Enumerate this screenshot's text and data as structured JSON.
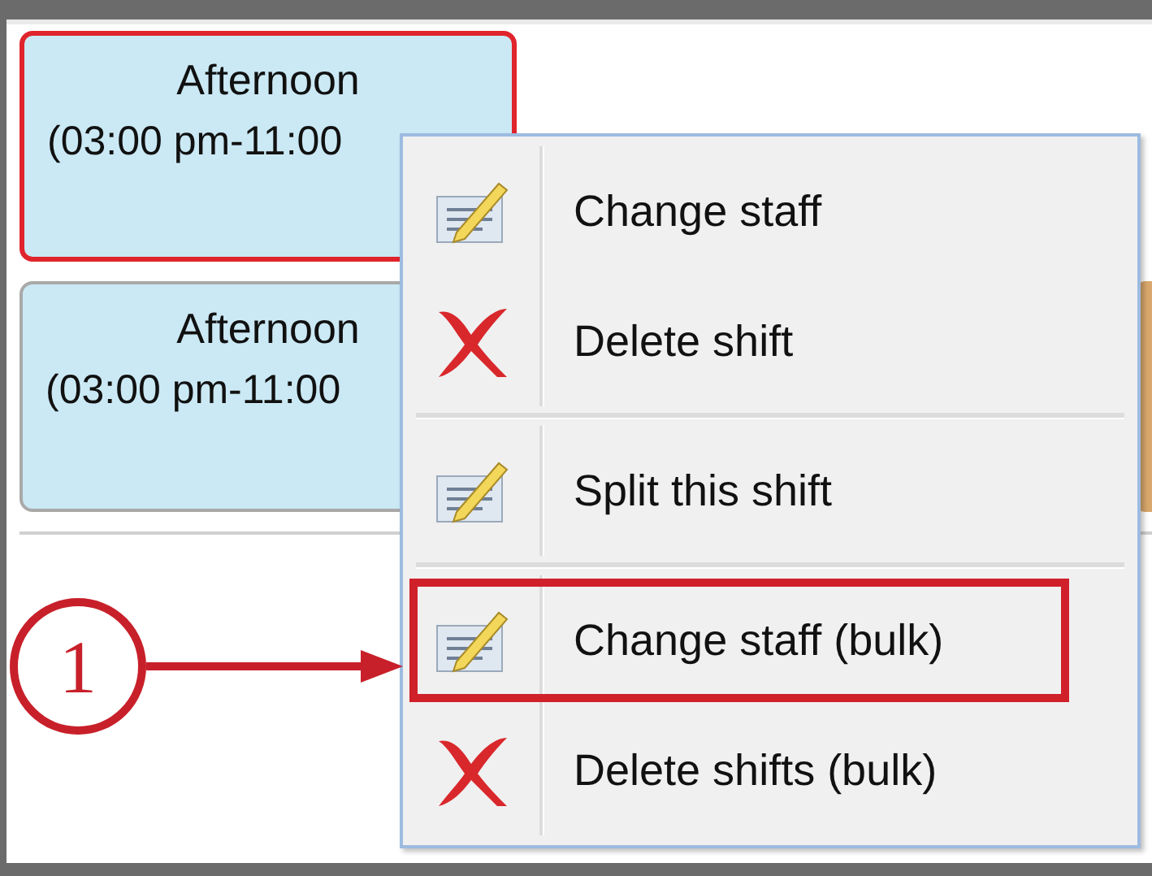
{
  "shifts": [
    {
      "title": "Afternoon",
      "time": "(03:00 pm-11:00",
      "selected": true
    },
    {
      "title": "Afternoon",
      "time": "(03:00 pm-11:00",
      "selected": false
    }
  ],
  "context_menu": {
    "items": [
      {
        "kind": "edit",
        "label": "Change staff",
        "highlighted": false
      },
      {
        "kind": "delete",
        "label": "Delete shift",
        "highlighted": false
      },
      {
        "kind": "separator"
      },
      {
        "kind": "edit",
        "label": "Split this shift",
        "highlighted": false
      },
      {
        "kind": "separator"
      },
      {
        "kind": "edit",
        "label": "Change staff (bulk)",
        "highlighted": true
      },
      {
        "kind": "delete",
        "label": "Delete shifts (bulk)",
        "highlighted": false
      }
    ]
  },
  "callout": {
    "label": "1"
  }
}
